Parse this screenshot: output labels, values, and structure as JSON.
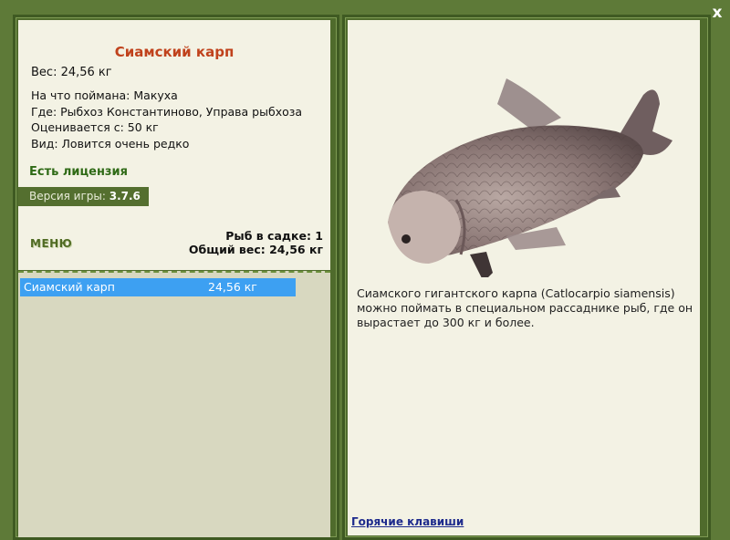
{
  "close_glyph": "x",
  "fish": {
    "name": "Сиамский карп",
    "weight_line": "Вес: 24,56 кг",
    "caught_on": "На что поймана: Макуха",
    "where": "Где: Рыбхоз Константиново, Управа рыбхоза",
    "valued": "Оценивается с: 50 кг",
    "rarity": "Вид: Ловится очень редко"
  },
  "license": "Есть лицензия",
  "version": {
    "label": "Версия игры:",
    "value": "3.7.6"
  },
  "menu_label": "МЕНЮ",
  "keep": {
    "count": "Рыб в садке: 1",
    "total": "Общий вес: 24,56 кг"
  },
  "catch_list": [
    {
      "name": "Сиамский карп",
      "weight": "24,56 кг"
    }
  ],
  "description": "Сиамского гигантского карпа (Catlocarpio siamensis) можно поймать в специальном рассаднике рыб, где он вырастает до 300 кг и более.",
  "hotkeys_label": "Горячие клавиши",
  "colors": {
    "frame": "#5e7a38",
    "title": "#c0421c",
    "license": "#2f6a16",
    "selected_row": "#3da0f2",
    "link": "#1d2a8c"
  },
  "icons": {
    "close": "close-icon",
    "fish": "fish-illustration"
  }
}
